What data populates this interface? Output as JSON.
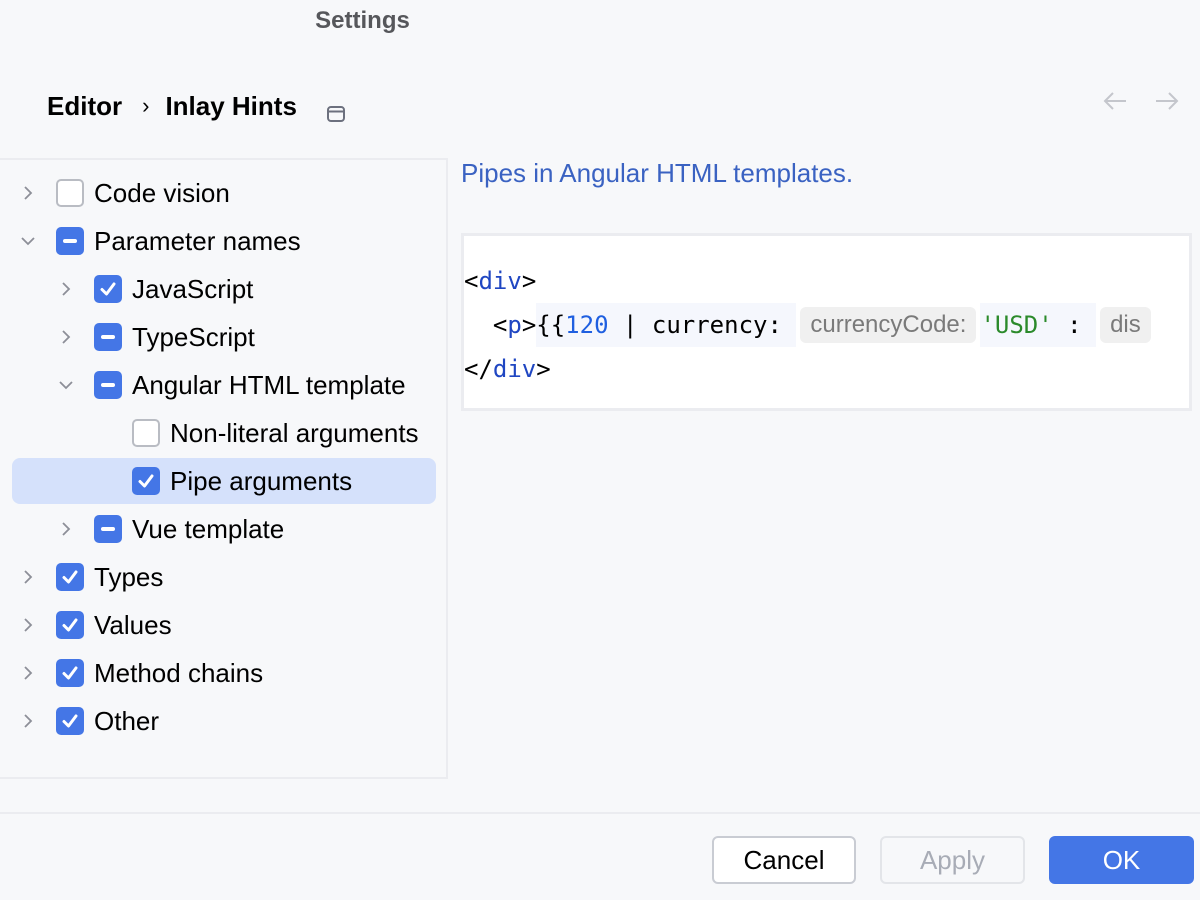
{
  "window": {
    "title": "Settings"
  },
  "breadcrumb": {
    "items": [
      "Editor",
      "Inlay Hints"
    ],
    "separator": "›"
  },
  "icons": {
    "pin": "window-pin-icon",
    "back": "arrow-left-icon",
    "forward": "arrow-right-icon",
    "expand": "chevron-right-icon",
    "collapse": "chevron-down-icon"
  },
  "tree": {
    "items": [
      {
        "label": "Code vision",
        "level": 0,
        "expander": "collapsed",
        "state": "unchecked",
        "selected": false
      },
      {
        "label": "Parameter names",
        "level": 0,
        "expander": "expanded",
        "state": "partial",
        "selected": false
      },
      {
        "label": "JavaScript",
        "level": 1,
        "expander": "collapsed",
        "state": "checked",
        "selected": false
      },
      {
        "label": "TypeScript",
        "level": 1,
        "expander": "collapsed",
        "state": "partial",
        "selected": false
      },
      {
        "label": "Angular HTML template",
        "level": 1,
        "expander": "expanded",
        "state": "partial",
        "selected": false
      },
      {
        "label": "Non-literal arguments",
        "level": 2,
        "expander": "none",
        "state": "unchecked",
        "selected": false
      },
      {
        "label": "Pipe arguments",
        "level": 2,
        "expander": "none",
        "state": "checked",
        "selected": true
      },
      {
        "label": "Vue template",
        "level": 1,
        "expander": "collapsed",
        "state": "partial",
        "selected": false
      },
      {
        "label": "Types",
        "level": 0,
        "expander": "collapsed",
        "state": "checked",
        "selected": false
      },
      {
        "label": "Values",
        "level": 0,
        "expander": "collapsed",
        "state": "checked",
        "selected": false
      },
      {
        "label": "Method chains",
        "level": 0,
        "expander": "collapsed",
        "state": "checked",
        "selected": false
      },
      {
        "label": "Other",
        "level": 0,
        "expander": "collapsed",
        "state": "checked",
        "selected": false
      }
    ]
  },
  "detail": {
    "description": "Pipes in Angular HTML templates.",
    "code": {
      "line1": {
        "open": "<",
        "tag": "div",
        "close": ">"
      },
      "line2": {
        "indent": "  ",
        "open": "<",
        "tag": "p",
        "close": ">",
        "braces": "{{",
        "number": "120",
        "rest": " | currency: ",
        "hint1": "currencyCode:",
        "string": "'USD'",
        "colon": " : ",
        "hint2": "dis"
      },
      "line3": {
        "open": "</",
        "tag": "div",
        "close": ">"
      }
    }
  },
  "buttons": {
    "cancel": "Cancel",
    "apply": "Apply",
    "ok": "OK"
  },
  "colors": {
    "accent": "#4476e6",
    "selection": "#d5e1fb",
    "link": "#3a62c2",
    "string": "#2b8a2b"
  }
}
